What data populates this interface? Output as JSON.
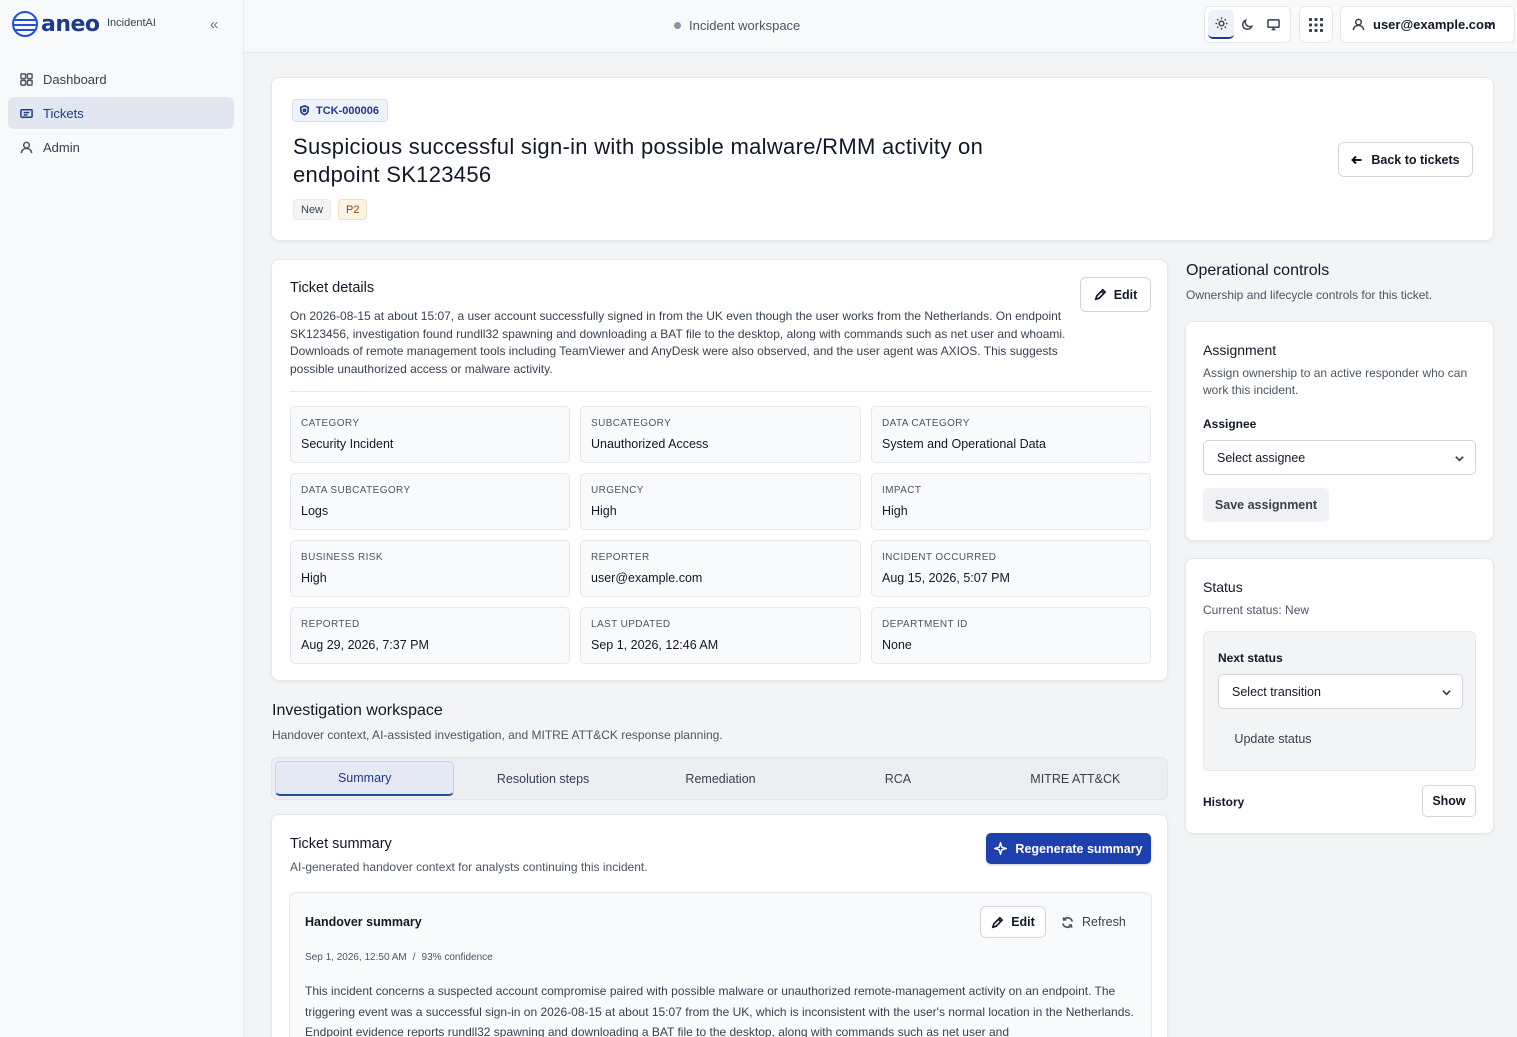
{
  "brand": {
    "name": "aneo",
    "app": "IncidentAI"
  },
  "sidebar": {
    "items": [
      {
        "label": "Dashboard",
        "icon": "grid-icon",
        "active": false
      },
      {
        "label": "Tickets",
        "icon": "ticket-icon",
        "active": true
      },
      {
        "label": "Admin",
        "icon": "user-icon",
        "active": false
      }
    ]
  },
  "topbar": {
    "workspace": "Incident workspace",
    "user": "user@example.com",
    "theme": "light"
  },
  "ticket": {
    "id": "TCK-000006",
    "title": "Suspicious successful sign-in with possible malware/RMM activity on endpoint SK123456",
    "status": "New",
    "priority": "P2",
    "back_label": "Back to tickets"
  },
  "details": {
    "title": "Ticket details",
    "edit_label": "Edit",
    "description": "On 2026-08-15 at about 15:07, a user account successfully signed in from the UK even though the user works from the Netherlands. On endpoint SK123456, investigation found rundll32 spawning and downloading a BAT file to the desktop, along with commands such as net user and whoami. Downloads of remote management tools including TeamViewer and AnyDesk were also observed, and the user agent was AXIOS. This suggests possible unauthorized access or malware activity.",
    "fields": [
      {
        "label": "CATEGORY",
        "value": "Security Incident"
      },
      {
        "label": "SUBCATEGORY",
        "value": "Unauthorized Access"
      },
      {
        "label": "DATA CATEGORY",
        "value": "System and Operational Data"
      },
      {
        "label": "DATA SUBCATEGORY",
        "value": "Logs"
      },
      {
        "label": "URGENCY",
        "value": "High"
      },
      {
        "label": "IMPACT",
        "value": "High"
      },
      {
        "label": "BUSINESS RISK",
        "value": "High"
      },
      {
        "label": "REPORTER",
        "value": "user@example.com"
      },
      {
        "label": "INCIDENT OCCURRED",
        "value": "Aug 15, 2026, 5:07 PM"
      },
      {
        "label": "REPORTED",
        "value": "Aug 29, 2026, 7:37 PM"
      },
      {
        "label": "LAST UPDATED",
        "value": "Sep 1, 2026, 12:46 AM"
      },
      {
        "label": "DEPARTMENT ID",
        "value": "None"
      }
    ]
  },
  "investigation": {
    "title": "Investigation workspace",
    "subtitle": "Handover context, AI-assisted investigation, and MITRE ATT&CK response planning.",
    "tabs": [
      {
        "label": "Summary",
        "active": true
      },
      {
        "label": "Resolution steps",
        "active": false
      },
      {
        "label": "Remediation",
        "active": false
      },
      {
        "label": "RCA",
        "active": false
      },
      {
        "label": "MITRE ATT&CK",
        "active": false
      }
    ]
  },
  "summary": {
    "title": "Ticket summary",
    "subtitle": "AI-generated handover context for analysts continuing this incident.",
    "regenerate_label": "Regenerate summary",
    "handover": {
      "title": "Handover summary",
      "edit_label": "Edit",
      "refresh_label": "Refresh",
      "timestamp": "Sep 1, 2026, 12:50 AM",
      "separator": "/",
      "confidence": "93% confidence",
      "text": "This incident concerns a suspected account compromise paired with possible malware or unauthorized remote-management activity on an endpoint. The triggering event was a successful sign-in on 2026-08-15 at about 15:07 from the UK, which is inconsistent with the user's normal location in the Netherlands. Endpoint evidence reports rundll32 spawning and downloading a BAT file to the desktop, along with commands such as net user and"
    }
  },
  "operational": {
    "title": "Operational controls",
    "subtitle": "Ownership and lifecycle controls for this ticket.",
    "assignment": {
      "title": "Assignment",
      "subtitle": "Assign ownership to an active responder who can work this incident.",
      "assignee_label": "Assignee",
      "assignee_placeholder": "Select assignee",
      "save_label": "Save assignment"
    },
    "status": {
      "title": "Status",
      "current": "Current status: New",
      "next_label": "Next status",
      "transition_placeholder": "Select transition",
      "update_label": "Update status",
      "history_label": "History",
      "show_label": "Show"
    }
  }
}
